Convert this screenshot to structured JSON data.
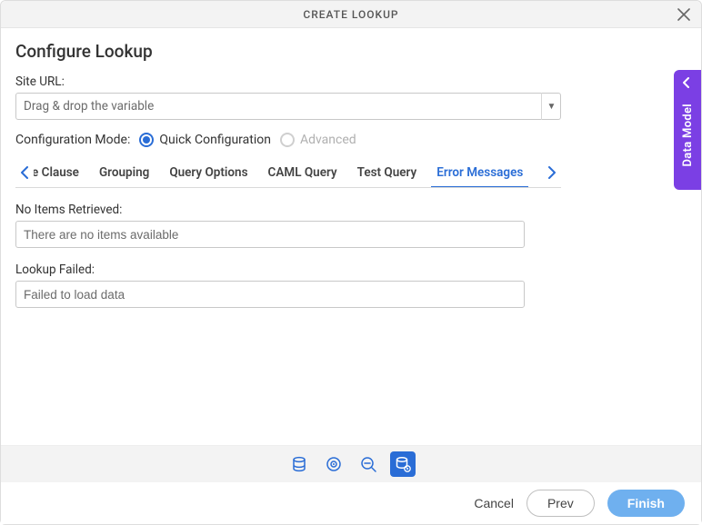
{
  "titlebar": {
    "title": "CREATE LOOKUP"
  },
  "page_title": "Configure Lookup",
  "site_url": {
    "label": "Site URL:",
    "placeholder": "Drag & drop the variable"
  },
  "config_mode": {
    "label": "Configuration Mode:",
    "quick": "Quick Configuration",
    "advanced": "Advanced"
  },
  "tabs": {
    "partial_head": "e Clause",
    "grouping": "Grouping",
    "query_options": "Query Options",
    "caml_query": "CAML Query",
    "test_query": "Test Query",
    "error_messages": "Error Messages"
  },
  "errors": {
    "no_items_label": "No Items Retrieved:",
    "no_items_value": "There are no items available",
    "lookup_failed_label": "Lookup Failed:",
    "lookup_failed_value": "Failed to load data"
  },
  "footer": {
    "cancel": "Cancel",
    "prev": "Prev",
    "finish": "Finish"
  },
  "side_panel": {
    "label": "Data Model"
  }
}
